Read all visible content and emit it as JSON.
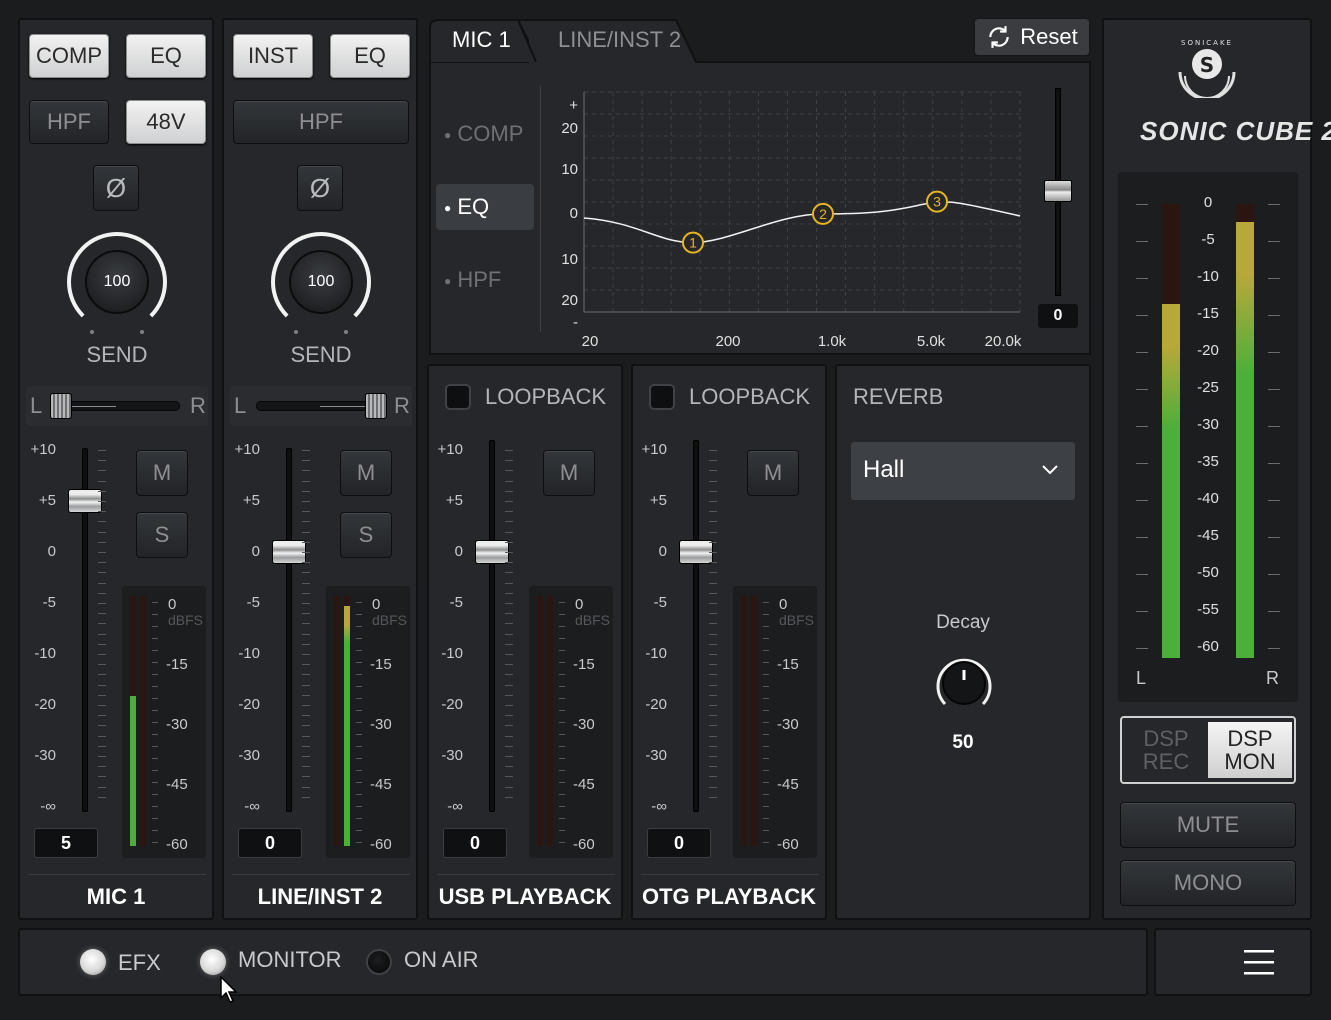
{
  "channels": [
    {
      "name": "MIC 1",
      "buttons": {
        "row1": [
          "COMP",
          "EQ"
        ],
        "row2": [
          "HPF",
          "48V"
        ]
      },
      "phase_label": "Ø",
      "send_value": "100",
      "send_label": "SEND",
      "pan": {
        "left": "L",
        "right": "R"
      },
      "fader_scale": [
        "+10",
        "+5",
        "0",
        "-5",
        "-10",
        "-20",
        "-30",
        "-∞"
      ],
      "fader_db": 5,
      "mute": "M",
      "solo": "S",
      "meter_scale": [
        "0",
        "-15",
        "-30",
        "-45",
        "-60"
      ],
      "meter_unit": "dBFS",
      "meter_level": 0.6,
      "meter_level_right": 0.0,
      "value": "5"
    },
    {
      "name": "LINE/INST 2",
      "buttons": {
        "row1": [
          "INST",
          "EQ"
        ],
        "row2": [
          "HPF"
        ]
      },
      "phase_label": "Ø",
      "send_value": "100",
      "send_label": "SEND",
      "pan": {
        "left": "L",
        "right": "R"
      },
      "fader_scale": [
        "+10",
        "+5",
        "0",
        "-5",
        "-10",
        "-20",
        "-30",
        "-∞"
      ],
      "fader_db": 0,
      "mute": "M",
      "solo": "S",
      "meter_scale": [
        "0",
        "-15",
        "-30",
        "-45",
        "-60"
      ],
      "meter_unit": "dBFS",
      "meter_level": 0.0,
      "meter_level_right": 0.96,
      "value": "0"
    },
    {
      "name": "USB PLAYBACK",
      "loopback_label": "LOOPBACK",
      "fader_scale": [
        "+10",
        "+5",
        "0",
        "-5",
        "-10",
        "-20",
        "-30",
        "-∞"
      ],
      "fader_db": 0,
      "mute": "M",
      "meter_scale": [
        "0",
        "-15",
        "-30",
        "-45",
        "-60"
      ],
      "meter_unit": "dBFS",
      "value": "0"
    },
    {
      "name": "OTG PLAYBACK",
      "loopback_label": "LOOPBACK",
      "fader_scale": [
        "+10",
        "+5",
        "0",
        "-5",
        "-10",
        "-20",
        "-30",
        "-∞"
      ],
      "fader_db": 0,
      "mute": "M",
      "meter_scale": [
        "0",
        "-15",
        "-30",
        "-45",
        "-60"
      ],
      "meter_unit": "dBFS",
      "value": "0"
    }
  ],
  "eq_panel": {
    "tabs": [
      "MIC 1",
      "LINE/INST 2"
    ],
    "active_tab": "MIC 1",
    "reset_label": "Reset",
    "sections": [
      "COMP",
      "EQ",
      "HPF"
    ],
    "active_section": "EQ",
    "gain_ticks": [
      "+",
      "20",
      "10",
      "0",
      "10",
      "20",
      "-"
    ],
    "freq_ticks": [
      "20",
      "200",
      "1.0k",
      "5.0k",
      "20.0k"
    ],
    "points": [
      {
        "label": "1",
        "freq": "~150 Hz",
        "gain_db": -6
      },
      {
        "label": "2",
        "freq": "~1.0k",
        "gain_db": 1
      },
      {
        "label": "3",
        "freq": "~5.0k",
        "gain_db": 4
      }
    ],
    "output_value": "0"
  },
  "reverb": {
    "title": "REVERB",
    "preset": "Hall",
    "decay_label": "Decay",
    "decay_value": "50"
  },
  "master": {
    "brand_badge_letter": "S",
    "brand_badge_ring": "SONICAKE",
    "brand_title": "SONIC CUBE 2",
    "scale": [
      "0",
      "-5",
      "-10",
      "-15",
      "-20",
      "-25",
      "-30",
      "-35",
      "-40",
      "-45",
      "-50",
      "-55",
      "-60"
    ],
    "left": "L",
    "right": "R",
    "level_left": 0.78,
    "level_right": 0.96,
    "dsp_rec": [
      "DSP",
      "REC"
    ],
    "dsp_mon": [
      "DSP",
      "MON"
    ],
    "mute": "MUTE",
    "mono": "MONO"
  },
  "bottom": {
    "efx": "EFX",
    "monitor": "MONITOR",
    "on_air": "ON AIR"
  },
  "colors": {
    "accent_yellow": "#e8b520",
    "meter_green": "#4caf3a",
    "meter_yellow": "#b8a83a"
  }
}
